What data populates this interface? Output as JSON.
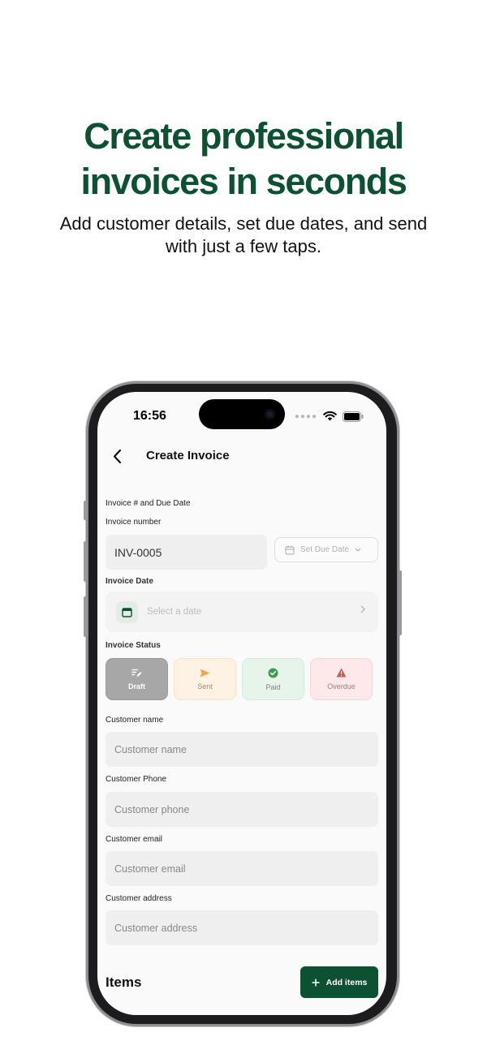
{
  "promo": {
    "headline": "Create professional\ninvoices in seconds",
    "subhead": "Add customer details, set due dates, and send\nwith just a few taps."
  },
  "status_bar": {
    "time": "16:56"
  },
  "nav": {
    "title": "Create Invoice"
  },
  "form": {
    "section_label": "Invoice # and Due Date",
    "invoice_number_label": "Invoice number",
    "invoice_number_value": "INV-0005",
    "due_date_button": "Set Due Date",
    "invoice_date_label": "Invoice Date",
    "invoice_date_placeholder": "Select a date",
    "invoice_status_label": "Invoice Status",
    "statuses": [
      {
        "label": "Draft",
        "icon": "draft-edit-icon",
        "selected": true,
        "color": "#a7a7a7"
      },
      {
        "label": "Sent",
        "icon": "send-icon",
        "selected": false,
        "color": "#f0a44a"
      },
      {
        "label": "Paid",
        "icon": "check-circle-icon",
        "selected": false,
        "color": "#3f9a55"
      },
      {
        "label": "Overdue",
        "icon": "warning-icon",
        "selected": false,
        "color": "#d9534f"
      }
    ],
    "customer_name_label": "Customer name",
    "customer_name_placeholder": "Customer name",
    "customer_phone_label": "Customer Phone",
    "customer_phone_placeholder": "Customer phone",
    "customer_email_label": "Customer email",
    "customer_email_placeholder": "Customer email",
    "customer_address_label": "Customer address",
    "customer_address_placeholder": "Customer address"
  },
  "items": {
    "title": "Items",
    "add_button": "Add items"
  },
  "colors": {
    "brand_green": "#0b5132"
  }
}
